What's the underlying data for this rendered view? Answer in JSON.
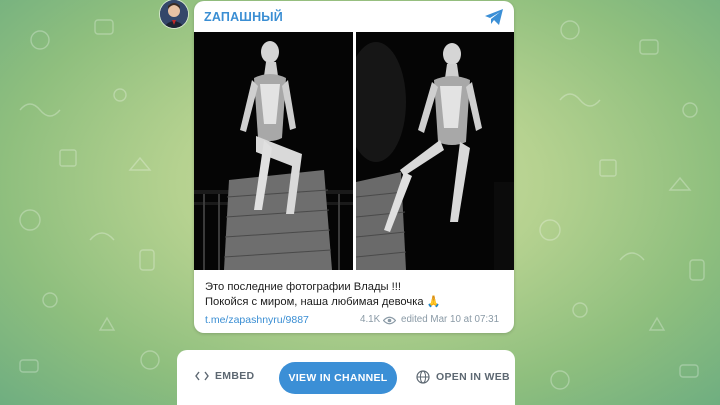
{
  "channel": {
    "name": "ZАПАШНЫЙ"
  },
  "icons": {
    "avatar": "avatar",
    "telegram": "telegram-plane-icon",
    "views": "eye-icon",
    "embed": "code-brackets-icon",
    "web": "globe-icon"
  },
  "message": {
    "line1": "Это последние фотографии Влады !!!",
    "line2": "Покойся с миром, наша любимая девочка 🙏",
    "link": "t.me/zapashnyru/9887",
    "views": "4.1K",
    "edited": "edited  Mar 10 at 07:31"
  },
  "actions": {
    "embed": "EMBED",
    "view_in_channel": "VIEW IN CHANNEL",
    "open_in_web": "OPEN IN WEB"
  },
  "colors": {
    "accent": "#3b8fd6",
    "link": "#3a8ed3",
    "background_green": "#8fbf7e"
  }
}
